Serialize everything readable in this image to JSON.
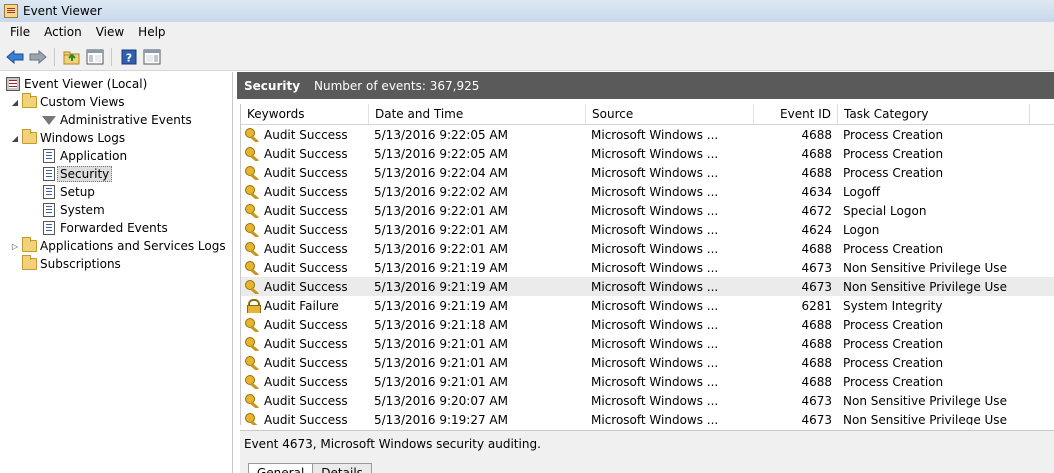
{
  "window": {
    "title": "Event Viewer"
  },
  "menu": [
    "File",
    "Action",
    "View",
    "Help"
  ],
  "toolbar": {
    "icons": [
      "back-arrow-icon",
      "forward-arrow-icon",
      "up-folder-icon",
      "show-hide-tree-icon",
      "help-icon",
      "show-hide-action-pane-icon"
    ]
  },
  "tree": {
    "root": "Event Viewer (Local)",
    "custom_views": "Custom Views",
    "administrative_events": "Administrative Events",
    "windows_logs": "Windows Logs",
    "application": "Application",
    "security": "Security",
    "setup": "Setup",
    "system": "System",
    "forwarded_events": "Forwarded Events",
    "apps_services": "Applications and Services Logs",
    "subscriptions": "Subscriptions"
  },
  "pane": {
    "title": "Security",
    "count_text": "Number of events: 367,925"
  },
  "columns": [
    "Keywords",
    "Date and Time",
    "Source",
    "Event ID",
    "Task Category"
  ],
  "rows": [
    {
      "keyword": "Audit Success",
      "icon": "key",
      "datetime": "5/13/2016 9:22:05 AM",
      "source": "Microsoft Windows ...",
      "event_id": "4688",
      "category": "Process Creation"
    },
    {
      "keyword": "Audit Success",
      "icon": "key",
      "datetime": "5/13/2016 9:22:05 AM",
      "source": "Microsoft Windows ...",
      "event_id": "4688",
      "category": "Process Creation"
    },
    {
      "keyword": "Audit Success",
      "icon": "key",
      "datetime": "5/13/2016 9:22:04 AM",
      "source": "Microsoft Windows ...",
      "event_id": "4688",
      "category": "Process Creation"
    },
    {
      "keyword": "Audit Success",
      "icon": "key",
      "datetime": "5/13/2016 9:22:02 AM",
      "source": "Microsoft Windows ...",
      "event_id": "4634",
      "category": "Logoff"
    },
    {
      "keyword": "Audit Success",
      "icon": "key",
      "datetime": "5/13/2016 9:22:01 AM",
      "source": "Microsoft Windows ...",
      "event_id": "4672",
      "category": "Special Logon"
    },
    {
      "keyword": "Audit Success",
      "icon": "key",
      "datetime": "5/13/2016 9:22:01 AM",
      "source": "Microsoft Windows ...",
      "event_id": "4624",
      "category": "Logon"
    },
    {
      "keyword": "Audit Success",
      "icon": "key",
      "datetime": "5/13/2016 9:22:01 AM",
      "source": "Microsoft Windows ...",
      "event_id": "4688",
      "category": "Process Creation"
    },
    {
      "keyword": "Audit Success",
      "icon": "key",
      "datetime": "5/13/2016 9:21:19 AM",
      "source": "Microsoft Windows ...",
      "event_id": "4673",
      "category": "Non Sensitive Privilege Use"
    },
    {
      "keyword": "Audit Success",
      "icon": "key",
      "datetime": "5/13/2016 9:21:19 AM",
      "source": "Microsoft Windows ...",
      "event_id": "4673",
      "category": "Non Sensitive Privilege Use",
      "highlighted": true
    },
    {
      "keyword": "Audit Failure",
      "icon": "lock",
      "datetime": "5/13/2016 9:21:19 AM",
      "source": "Microsoft Windows ...",
      "event_id": "6281",
      "category": "System Integrity"
    },
    {
      "keyword": "Audit Success",
      "icon": "key",
      "datetime": "5/13/2016 9:21:18 AM",
      "source": "Microsoft Windows ...",
      "event_id": "4688",
      "category": "Process Creation"
    },
    {
      "keyword": "Audit Success",
      "icon": "key",
      "datetime": "5/13/2016 9:21:01 AM",
      "source": "Microsoft Windows ...",
      "event_id": "4688",
      "category": "Process Creation"
    },
    {
      "keyword": "Audit Success",
      "icon": "key",
      "datetime": "5/13/2016 9:21:01 AM",
      "source": "Microsoft Windows ...",
      "event_id": "4688",
      "category": "Process Creation"
    },
    {
      "keyword": "Audit Success",
      "icon": "key",
      "datetime": "5/13/2016 9:21:01 AM",
      "source": "Microsoft Windows ...",
      "event_id": "4688",
      "category": "Process Creation"
    },
    {
      "keyword": "Audit Success",
      "icon": "key",
      "datetime": "5/13/2016 9:20:07 AM",
      "source": "Microsoft Windows ...",
      "event_id": "4673",
      "category": "Non Sensitive Privilege Use"
    },
    {
      "keyword": "Audit Success",
      "icon": "key",
      "datetime": "5/13/2016 9:19:27 AM",
      "source": "Microsoft Windows ...",
      "event_id": "4673",
      "category": "Non Sensitive Privilege Use"
    }
  ],
  "detail": {
    "title": "Event 4673, Microsoft Windows security auditing.",
    "tabs": [
      "General",
      "Details"
    ]
  },
  "colors": {
    "pane_header": "#5a5a5a",
    "highlight_row": "#ebebeb"
  }
}
